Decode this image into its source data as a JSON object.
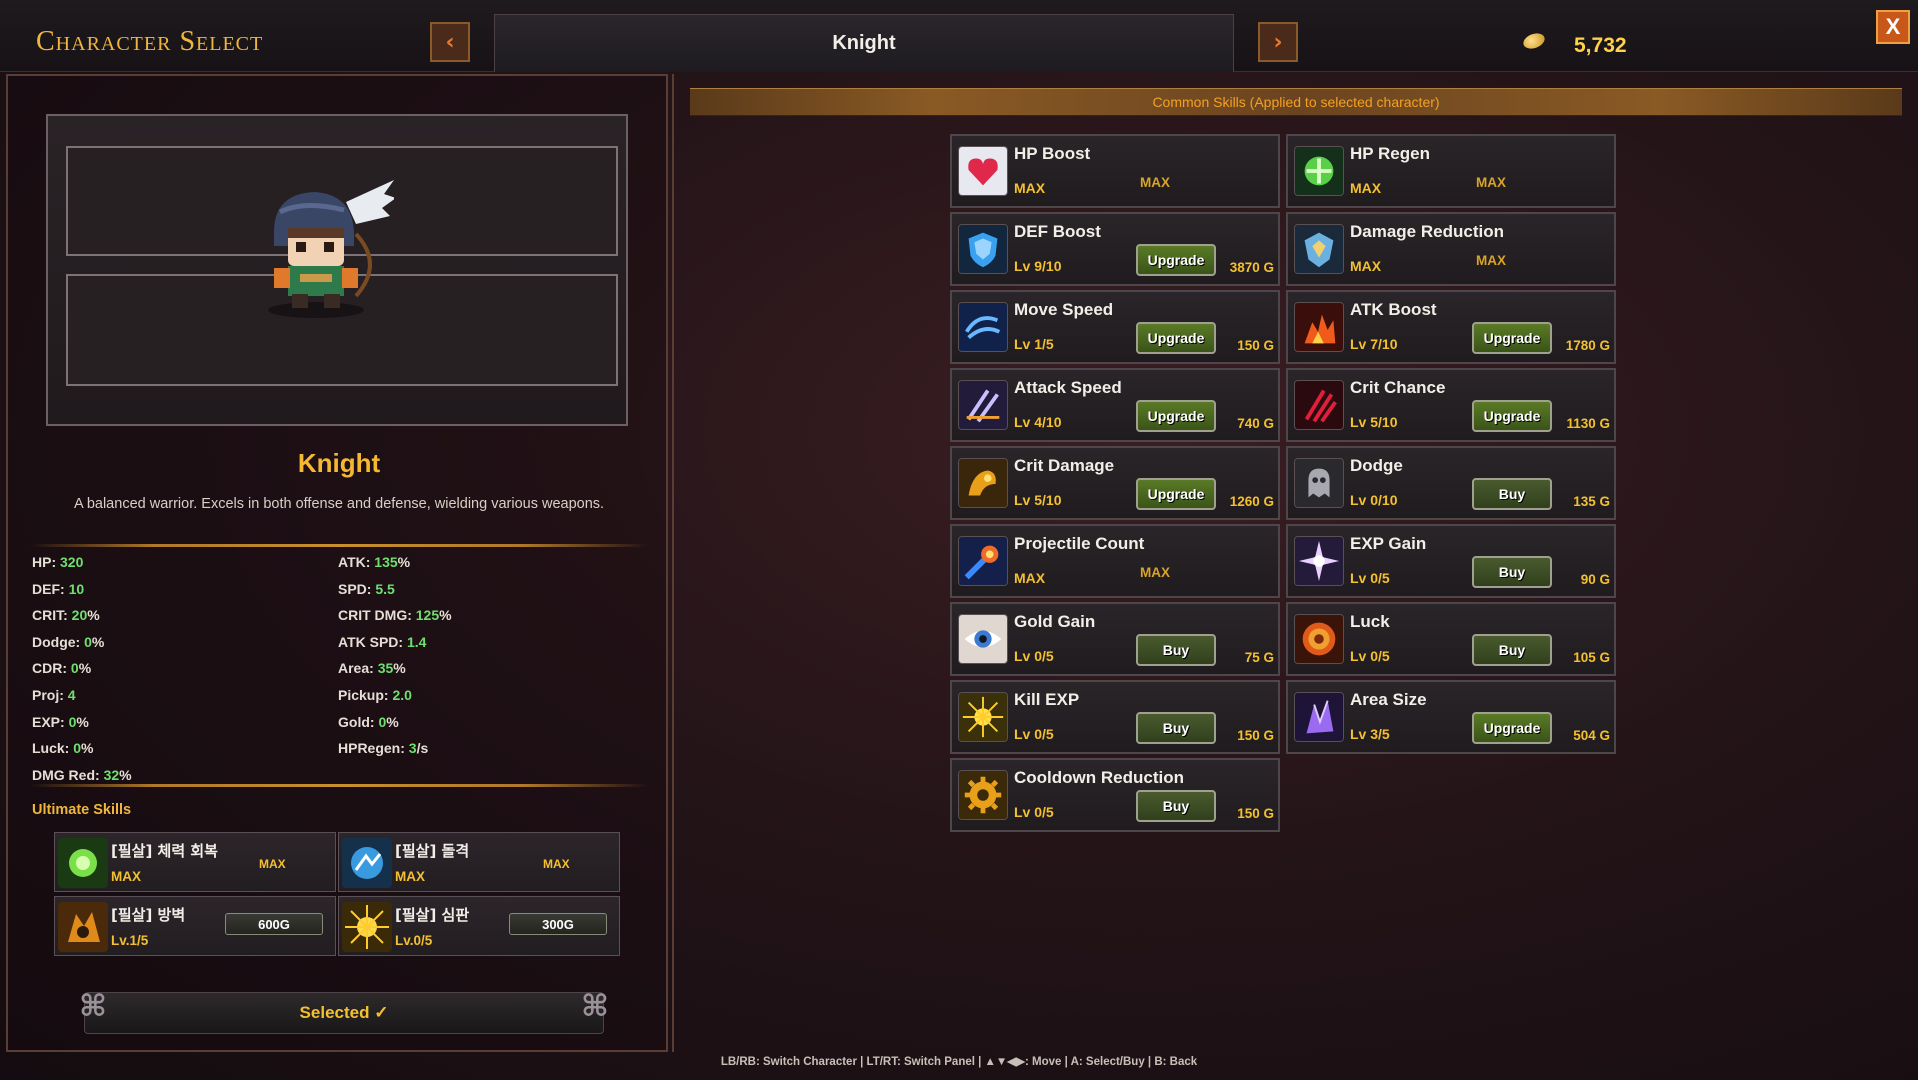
{
  "header": {
    "title": "Character Select",
    "prev_arrow": "‹",
    "next_arrow": "›",
    "character_tab": "Knight",
    "gold": "5,732",
    "close": "X"
  },
  "character": {
    "name": "Knight",
    "description": "A balanced warrior. Excels in both offense and defense, wielding various weapons."
  },
  "stats_left": [
    {
      "label": "HP: ",
      "value": "320",
      "unit": ""
    },
    {
      "label": "DEF: ",
      "value": "10",
      "unit": ""
    },
    {
      "label": "CRIT: ",
      "value": "20",
      "unit": "%"
    },
    {
      "label": "Dodge: ",
      "value": "0",
      "unit": "%"
    },
    {
      "label": "CDR: ",
      "value": "0",
      "unit": "%"
    },
    {
      "label": "Proj: ",
      "value": "4",
      "unit": ""
    },
    {
      "label": "EXP: ",
      "value": "0",
      "unit": "%"
    },
    {
      "label": "Luck: ",
      "value": "0",
      "unit": "%"
    },
    {
      "label": "DMG Red: ",
      "value": "32",
      "unit": "%"
    }
  ],
  "stats_right": [
    {
      "label": "ATK: ",
      "value": "135",
      "unit": "%"
    },
    {
      "label": "SPD: ",
      "value": "5.5",
      "unit": ""
    },
    {
      "label": "CRIT DMG: ",
      "value": "125",
      "unit": "%"
    },
    {
      "label": "ATK SPD: ",
      "value": "1.4",
      "unit": ""
    },
    {
      "label": "Area: ",
      "value": "35",
      "unit": "%"
    },
    {
      "label": "Pickup: ",
      "value": "2.0",
      "unit": ""
    },
    {
      "label": "Gold: ",
      "value": "0",
      "unit": "%"
    },
    {
      "label": "HPRegen: ",
      "value": "3",
      "unit": "/s"
    }
  ],
  "ultimate": {
    "title": "Ultimate Skills",
    "skills": [
      {
        "name": "[필살] 체력 회복",
        "level": "MAX",
        "status": "MAX",
        "icon": "heal-burst-icon"
      },
      {
        "name": "[필살] 돌격",
        "level": "MAX",
        "status": "MAX",
        "icon": "dash-icon"
      },
      {
        "name": "[필살] 방벽",
        "level": "Lv.1/5",
        "cost": "600G",
        "icon": "barrier-icon"
      },
      {
        "name": "[필살] 심판",
        "level": "Lv.0/5",
        "cost": "300G",
        "icon": "judgment-icon"
      }
    ]
  },
  "selected_button": "Selected ✓",
  "common_skills_banner": "Common Skills (Applied to selected character)",
  "skills": [
    {
      "name": "HP Boost",
      "level": "MAX",
      "action": "MAX",
      "cost": "",
      "icon": "heart-icon"
    },
    {
      "name": "HP Regen",
      "level": "MAX",
      "action": "MAX",
      "cost": "",
      "icon": "regen-icon"
    },
    {
      "name": "DEF Boost",
      "level": "Lv 9/10",
      "action": "Upgrade",
      "cost": "3870 G",
      "icon": "shield-icon"
    },
    {
      "name": "Damage Reduction",
      "level": "MAX",
      "action": "MAX",
      "cost": "",
      "icon": "gem-shield-icon"
    },
    {
      "name": "Move Speed",
      "level": "Lv 1/5",
      "action": "Upgrade",
      "cost": "150 G",
      "icon": "wind-icon"
    },
    {
      "name": "ATK Boost",
      "level": "Lv 7/10",
      "action": "Upgrade",
      "cost": "1780 G",
      "icon": "fire-burst-icon"
    },
    {
      "name": "Attack Speed",
      "level": "Lv 4/10",
      "action": "Upgrade",
      "cost": "740 G",
      "icon": "blades-icon"
    },
    {
      "name": "Crit Chance",
      "level": "Lv 5/10",
      "action": "Upgrade",
      "cost": "1130 G",
      "icon": "claw-icon"
    },
    {
      "name": "Crit Damage",
      "level": "Lv 5/10",
      "action": "Upgrade",
      "cost": "1260 G",
      "icon": "crit-damage-icon"
    },
    {
      "name": "Dodge",
      "level": "Lv 0/10",
      "action": "Buy",
      "cost": "135 G",
      "icon": "ghost-icon"
    },
    {
      "name": "Projectile Count",
      "level": "MAX",
      "action": "MAX",
      "cost": "",
      "icon": "comet-icon"
    },
    {
      "name": "EXP Gain",
      "level": "Lv 0/5",
      "action": "Buy",
      "cost": "90 G",
      "icon": "star-burst-icon"
    },
    {
      "name": "Gold Gain",
      "level": "Lv 0/5",
      "action": "Buy",
      "cost": "75 G",
      "icon": "eye-icon"
    },
    {
      "name": "Luck",
      "level": "Lv 0/5",
      "action": "Buy",
      "cost": "105 G",
      "icon": "lucky-coin-icon"
    },
    {
      "name": "Kill EXP",
      "level": "Lv 0/5",
      "action": "Buy",
      "cost": "150 G",
      "icon": "sun-icon"
    },
    {
      "name": "Area Size",
      "level": "Lv 3/5",
      "action": "Upgrade",
      "cost": "504 G",
      "icon": "crystal-icon"
    },
    {
      "name": "Cooldown Reduction",
      "level": "Lv 0/5",
      "action": "Buy",
      "cost": "150 G",
      "icon": "gear-icon"
    }
  ],
  "footer": "LB/RB: Switch Character  |  LT/RT: Switch Panel  |  ▲▼◀▶: Move  |  A: Select/Buy  |  B: Back"
}
